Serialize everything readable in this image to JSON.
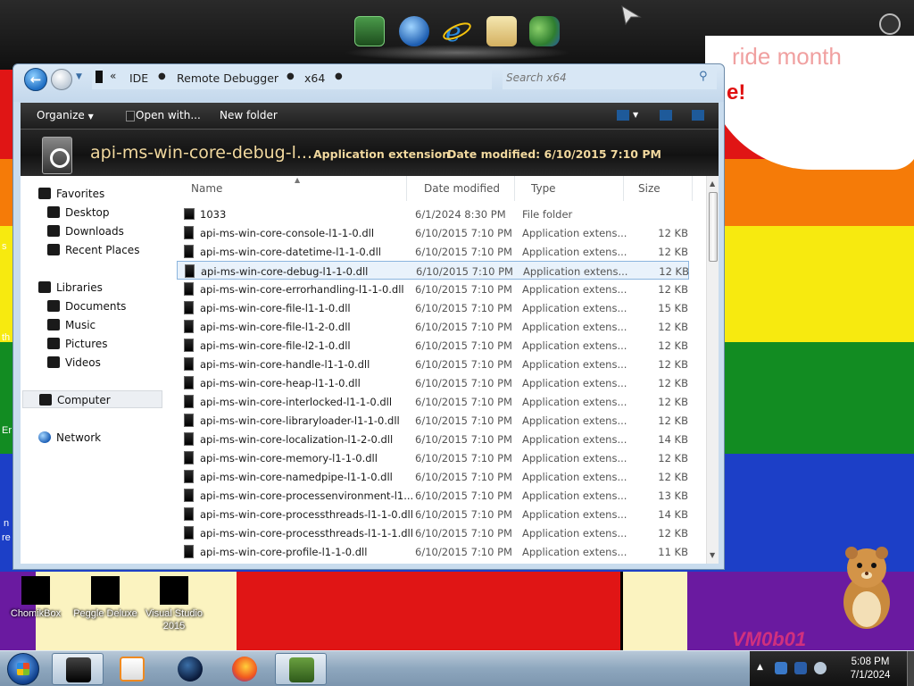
{
  "wallpaper": {
    "speech_text_1": "ride month",
    "speech_text_2": "e!",
    "side_labels": [
      "s",
      "th",
      "Er",
      "n",
      "re"
    ],
    "logo": "VM0b01",
    "colors": {
      "red": "#e01515",
      "orange": "#f57b08",
      "yellow": "#f7ea0f",
      "green": "#128c22",
      "blue": "#1c3fc7",
      "purple": "#6a1aa0"
    }
  },
  "top_dock": {
    "icons": [
      "terminal-icon",
      "globe-refresh-icon",
      "internet-explorer-icon",
      "mail-icon",
      "users-icon"
    ]
  },
  "desktop_icons": [
    {
      "label": "ChomikBox"
    },
    {
      "label": "Peggle Deluxe"
    },
    {
      "label": "Visual Studio 2015"
    }
  ],
  "explorer": {
    "breadcrumb": [
      "IDE",
      "Remote Debugger",
      "x64"
    ],
    "search_placeholder": "Search x64",
    "toolbar": {
      "organize": "Organize",
      "open_with": "Open with...",
      "new_folder": "New folder"
    },
    "details": {
      "name": "api-ms-win-core-debug-l...",
      "type": "Application extension",
      "date_modified_label": "Date modified:",
      "date_modified": "6/10/2015 7:10 PM"
    },
    "nav": {
      "favorites": "Favorites",
      "desktop": "Desktop",
      "downloads": "Downloads",
      "recent_places": "Recent Places",
      "libraries": "Libraries",
      "documents": "Documents",
      "music": "Music",
      "pictures": "Pictures",
      "videos": "Videos",
      "computer": "Computer",
      "network": "Network"
    },
    "columns": {
      "name": "Name",
      "date_modified": "Date modified",
      "type": "Type",
      "size": "Size"
    },
    "files": [
      {
        "name": "1033",
        "date": "6/1/2024 8:30 PM",
        "type": "File folder",
        "size": ""
      },
      {
        "name": "api-ms-win-core-console-l1-1-0.dll",
        "date": "6/10/2015 7:10 PM",
        "type": "Application extens...",
        "size": "12 KB"
      },
      {
        "name": "api-ms-win-core-datetime-l1-1-0.dll",
        "date": "6/10/2015 7:10 PM",
        "type": "Application extens...",
        "size": "12 KB"
      },
      {
        "name": "api-ms-win-core-debug-l1-1-0.dll",
        "date": "6/10/2015 7:10 PM",
        "type": "Application extens...",
        "size": "12 KB"
      },
      {
        "name": "api-ms-win-core-errorhandling-l1-1-0.dll",
        "date": "6/10/2015 7:10 PM",
        "type": "Application extens...",
        "size": "12 KB"
      },
      {
        "name": "api-ms-win-core-file-l1-1-0.dll",
        "date": "6/10/2015 7:10 PM",
        "type": "Application extens...",
        "size": "15 KB"
      },
      {
        "name": "api-ms-win-core-file-l1-2-0.dll",
        "date": "6/10/2015 7:10 PM",
        "type": "Application extens...",
        "size": "12 KB"
      },
      {
        "name": "api-ms-win-core-file-l2-1-0.dll",
        "date": "6/10/2015 7:10 PM",
        "type": "Application extens...",
        "size": "12 KB"
      },
      {
        "name": "api-ms-win-core-handle-l1-1-0.dll",
        "date": "6/10/2015 7:10 PM",
        "type": "Application extens...",
        "size": "12 KB"
      },
      {
        "name": "api-ms-win-core-heap-l1-1-0.dll",
        "date": "6/10/2015 7:10 PM",
        "type": "Application extens...",
        "size": "12 KB"
      },
      {
        "name": "api-ms-win-core-interlocked-l1-1-0.dll",
        "date": "6/10/2015 7:10 PM",
        "type": "Application extens...",
        "size": "12 KB"
      },
      {
        "name": "api-ms-win-core-libraryloader-l1-1-0.dll",
        "date": "6/10/2015 7:10 PM",
        "type": "Application extens...",
        "size": "12 KB"
      },
      {
        "name": "api-ms-win-core-localization-l1-2-0.dll",
        "date": "6/10/2015 7:10 PM",
        "type": "Application extens...",
        "size": "14 KB"
      },
      {
        "name": "api-ms-win-core-memory-l1-1-0.dll",
        "date": "6/10/2015 7:10 PM",
        "type": "Application extens...",
        "size": "12 KB"
      },
      {
        "name": "api-ms-win-core-namedpipe-l1-1-0.dll",
        "date": "6/10/2015 7:10 PM",
        "type": "Application extens...",
        "size": "12 KB"
      },
      {
        "name": "api-ms-win-core-processenvironment-l1...",
        "date": "6/10/2015 7:10 PM",
        "type": "Application extens...",
        "size": "13 KB"
      },
      {
        "name": "api-ms-win-core-processthreads-l1-1-0.dll",
        "date": "6/10/2015 7:10 PM",
        "type": "Application extens...",
        "size": "14 KB"
      },
      {
        "name": "api-ms-win-core-processthreads-l1-1-1.dll",
        "date": "6/10/2015 7:10 PM",
        "type": "Application extens...",
        "size": "12 KB"
      },
      {
        "name": "api-ms-win-core-profile-l1-1-0.dll",
        "date": "6/10/2015 7:10 PM",
        "type": "Application extens...",
        "size": "11 KB"
      }
    ],
    "selected_index": 3
  },
  "taskbar": {
    "pinned": [
      "explorer-window-icon",
      "media-player-icon",
      "world-icon",
      "firefox-icon",
      "chomikbox-icon"
    ],
    "active_index": 0,
    "clock_time": "5:08 PM",
    "clock_date": "7/1/2024"
  }
}
